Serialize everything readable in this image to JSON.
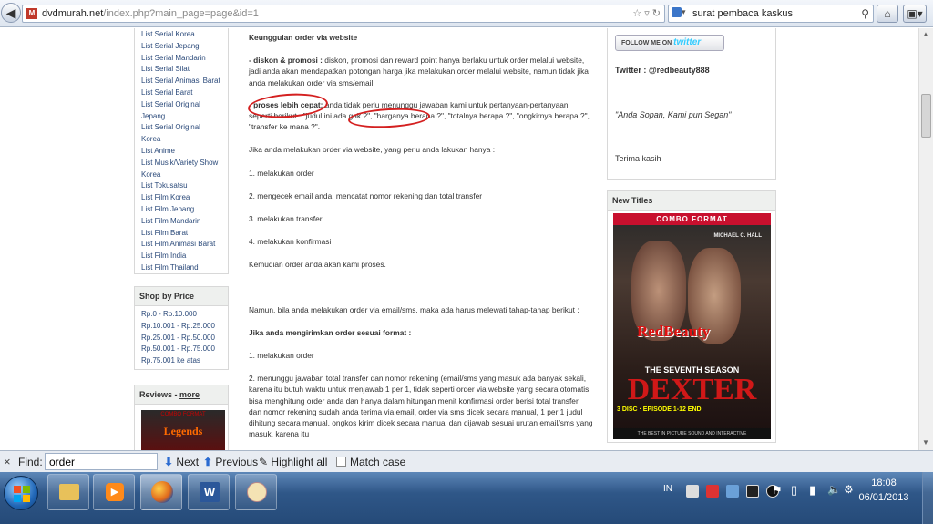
{
  "browser": {
    "site_icon": "M",
    "url_domain": "dvdmurah.net",
    "url_rest": "/index.php?main_page=page&id=1",
    "search_text": "surat pembaca kaskus"
  },
  "sidebar": {
    "category_items": [
      "List Serial Korea",
      "List Serial Jepang",
      "List Serial Mandarin",
      "List Serial Silat",
      "List Serial Animasi Barat",
      "List Serial Barat",
      "List Serial Original",
      "Jepang",
      "List Serial Original Korea",
      "List Anime",
      "List Musik/Variety Show",
      "Korea",
      "List Tokusatsu",
      "List Film Korea",
      "List Film Jepang",
      "List Film Mandarin",
      "List Film Barat",
      "List Film Animasi Barat",
      "List Film India",
      "List Film Thailand"
    ],
    "price_title": "Shop by Price",
    "price_items": [
      "Rp.0 - Rp.10.000",
      "Rp.10.001 - Rp.25.000",
      "Rp.25.001 - Rp.50.000",
      "Rp.50.001 - Rp.75.000",
      "Rp.75.001 ke atas"
    ],
    "reviews_title": "Reviews -",
    "reviews_more": "more",
    "review_img_top": "COMBO FORMAT",
    "review_img_title": "Legends"
  },
  "content": {
    "heading": "Keunggulan order via website",
    "p1_bold": "- diskon & promosi :",
    "p1_text": " diskon, promosi dan reward point hanya berlaku untuk order melalui website, jadi anda akan mendapatkan potongan harga jika melakukan order melalui website, namun tidak jika anda melakukan order via sms/email.",
    "p2_bold": "- proses lebih cepat:",
    "p2_text": " anda tidak perlu menunggu jawaban kami untuk pertanyaan-pertanyaan seperti berikut : \"judul ini ada gak ?\", \"harganya berapa ?\", \"totalnya berapa ?\", \"ongkirnya berapa ?\", \"transfer ke mana ?\".",
    "p3": "Jika anda melakukan order via website, yang perlu anda lakukan hanya :",
    "steps": [
      "1. melakukan order",
      "2. mengecek email anda, mencatat nomor rekening dan total transfer",
      "3. melakukan transfer",
      "4. melakukan konfirmasi"
    ],
    "p4": "Kemudian order anda akan kami proses.",
    "p5": "Namun, bila anda melakukan order via email/sms, maka ada harus melewati tahap-tahap berikut :",
    "p6_bold": "Jika anda mengirimkan order sesuai format :",
    "p7": "1. melakukan order",
    "p8": "2. menunggu jawaban total transfer dan nomor rekening (email/sms yang masuk ada banyak sekali, karena itu butuh waktu untuk menjawab 1 per 1, tidak seperti order via website yang secara otomatis bisa menghitung order anda dan hanya dalam hitungan menit konfirmasi order berisi total transfer dan nomor rekening sudah anda terima via email, order via sms dicek secara manual, 1 per 1 judul dihitung secara manual, ongkos kirim dicek secara manual dan dijawab sesuai urutan email/sms yang masuk, karena itu"
  },
  "right": {
    "follow_label": "FOLLOW ME ON",
    "follow_brand": "twitter",
    "twitter_label": "Twitter : @redbeauty888",
    "quote": "\"Anda Sopan, Kami pun Segan\"",
    "thanks": "Terima kasih",
    "new_titles": "New Titles",
    "dvd_top": "COMBO FORMAT",
    "dvd_actor": "MICHAEL C. HALL",
    "dvd_brand": "RedBeauty",
    "dvd_season": "THE SEVENTH SEASON",
    "dvd_title": "DEXTER",
    "dvd_disc": "3 DISC · EPISODE 1-12 END",
    "dvd_foot": "THE BEST IN PICTURE SOUND AND INTERACTIVE"
  },
  "findbar": {
    "close": "×",
    "label": "Find:",
    "value": "order",
    "next": "Next",
    "previous": "Previous",
    "highlight": "Highlight all",
    "match_case": "Match case"
  },
  "taskbar": {
    "lang": "IN",
    "time": "18:08",
    "date": "06/01/2013"
  }
}
